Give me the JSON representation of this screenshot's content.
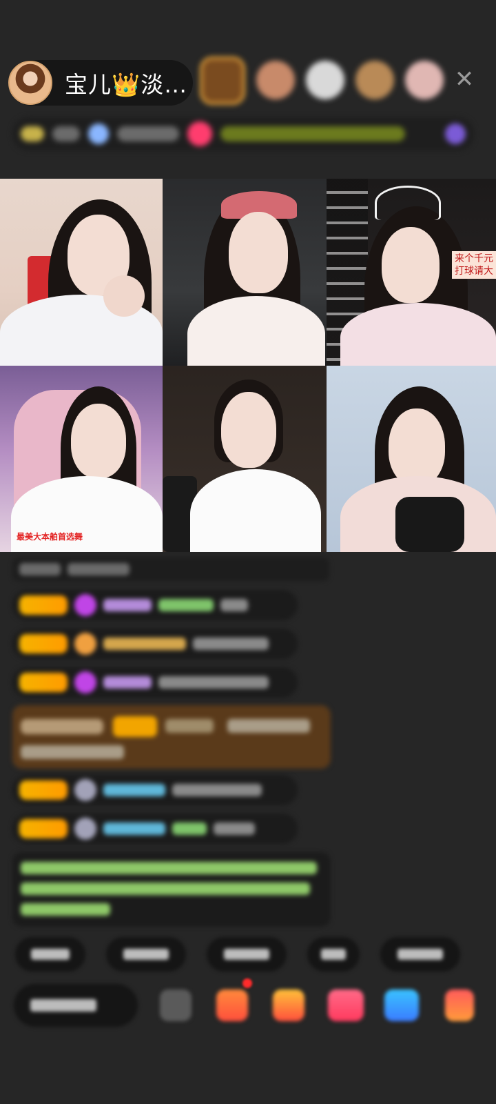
{
  "host": {
    "name": "宝儿👑淡…",
    "avatar_icon": "host-avatar"
  },
  "top_bar": {
    "viewer_avatar_count": 5,
    "close_icon": "close-icon",
    "close_glyph": "✕"
  },
  "video_grid": {
    "tiles": [
      {
        "slot": 1,
        "caption": ""
      },
      {
        "slot": 2,
        "caption": ""
      },
      {
        "slot": 3,
        "caption": "来个千元\n打球请大"
      },
      {
        "slot": 4,
        "caption": "最美大本舶首选舞"
      },
      {
        "slot": 5,
        "caption": ""
      },
      {
        "slot": 6,
        "caption": ""
      }
    ]
  },
  "colors": {
    "background": "#262626",
    "host_pill": "#161616",
    "level_badge": "#f6b300",
    "gift_highlight": "#5a3a1a",
    "system_text": "#9bd36b",
    "username_purple": "#b38bd9",
    "username_blue": "#5fb7d9"
  },
  "chat": {
    "note": "",
    "message_count": 9
  },
  "toolbar": {
    "icons": [
      "emoji-icon",
      "gift-box-icon",
      "gift-icon",
      "heart-icon",
      "share-icon",
      "more-icon"
    ]
  }
}
